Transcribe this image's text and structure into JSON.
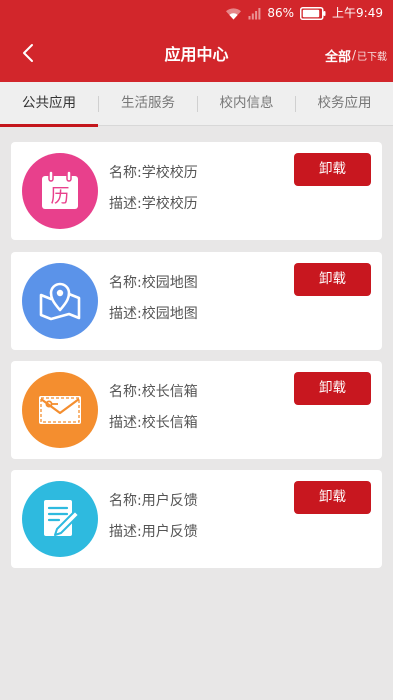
{
  "status_bar": {
    "battery": "86%",
    "time": "上午9:49"
  },
  "header": {
    "title": "应用中心",
    "filter_all": "全部",
    "filter_separator": "/",
    "filter_downloaded": "已下载"
  },
  "tabs": [
    {
      "label": "公共应用",
      "active": true
    },
    {
      "label": "生活服务",
      "active": false
    },
    {
      "label": "校内信息",
      "active": false
    },
    {
      "label": "校务应用",
      "active": false
    }
  ],
  "apps": [
    {
      "name": "名称:学校校历",
      "description": "描述:学校校历",
      "action": "卸载",
      "icon": "calendar-icon",
      "icon_text": "历",
      "icon_color": "#e8408c"
    },
    {
      "name": "名称:校园地图",
      "description": "描述:校园地图",
      "action": "卸载",
      "icon": "map-icon",
      "icon_color": "#5b93e9"
    },
    {
      "name": "名称:校长信箱",
      "description": "描述:校长信箱",
      "action": "卸载",
      "icon": "mailbox-icon",
      "icon_color": "#f48e2f"
    },
    {
      "name": "名称:用户反馈",
      "description": "描述:用户反馈",
      "action": "卸载",
      "icon": "feedback-icon",
      "icon_color": "#2ebadf"
    }
  ],
  "colors": {
    "primary": "#d2262b",
    "button": "#c8171f",
    "background": "#e8e7e7"
  }
}
